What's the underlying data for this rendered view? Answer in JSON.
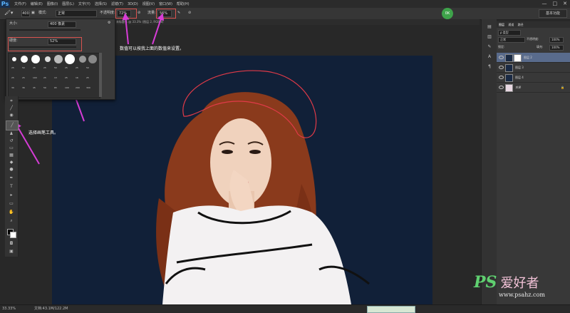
{
  "app": {
    "logo": "Ps"
  },
  "menu": [
    "文件(F)",
    "编辑(E)",
    "图像(I)",
    "图层(L)",
    "文字(Y)",
    "选择(S)",
    "滤镜(T)",
    "3D(D)",
    "视图(V)",
    "窗口(W)",
    "帮助(H)"
  ],
  "window_controls": [
    "—",
    "□",
    "✕"
  ],
  "options": {
    "brush_size": "400",
    "mode_label": "模式:",
    "mode_value": "正常",
    "opacity_label": "不透明度:",
    "opacity_value": "72%",
    "flow_label": "流量:",
    "flow_value": "56%",
    "workspace": "基本功能"
  },
  "user_badge": "0K",
  "doc_tab": "未标题-1 @ 33.3% (图层 2, RGB/8)",
  "brush_panel": {
    "size_label": "大小:",
    "size_value": "400 像素",
    "hardness_label": "硬度:",
    "hardness_value": "52%",
    "preset_numbers": [
      "25",
      "50",
      "25",
      "25",
      "50",
      "25",
      "25",
      "50",
      "25",
      "25",
      "100",
      "25",
      "13",
      "25",
      "16",
      "25",
      "30",
      "36",
      "45",
      "50",
      "65",
      "100",
      "200",
      "300"
    ]
  },
  "annotations": {
    "top": "数值可以按我上面的数值来设置。",
    "left": "选择画笔工具。"
  },
  "layers": {
    "tabs": [
      "图层",
      "通道",
      "路径"
    ],
    "kind_label": "ρ 类型",
    "blend": "正常",
    "opacity_label": "不透明度:",
    "opacity": "100%",
    "lock_label": "锁定:",
    "fill_label": "填充:",
    "fill": "100%",
    "items": [
      {
        "name": "图层 2",
        "selected": true
      },
      {
        "name": "图层 3",
        "selected": false
      },
      {
        "name": "图层 4",
        "selected": false
      },
      {
        "name": "背景",
        "selected": false
      }
    ]
  },
  "status": {
    "zoom": "33.33%",
    "doc_info": "文档:43.1M/122.2M"
  },
  "watermark": {
    "brand": "PS",
    "cn": "爱好者",
    "url": "www.psahz.com"
  },
  "colors": {
    "annotation_arrow": "#d63cd6",
    "highlight_box": "#d9534f",
    "canvas_bg": "#112038",
    "badge": "#3ea34a"
  }
}
